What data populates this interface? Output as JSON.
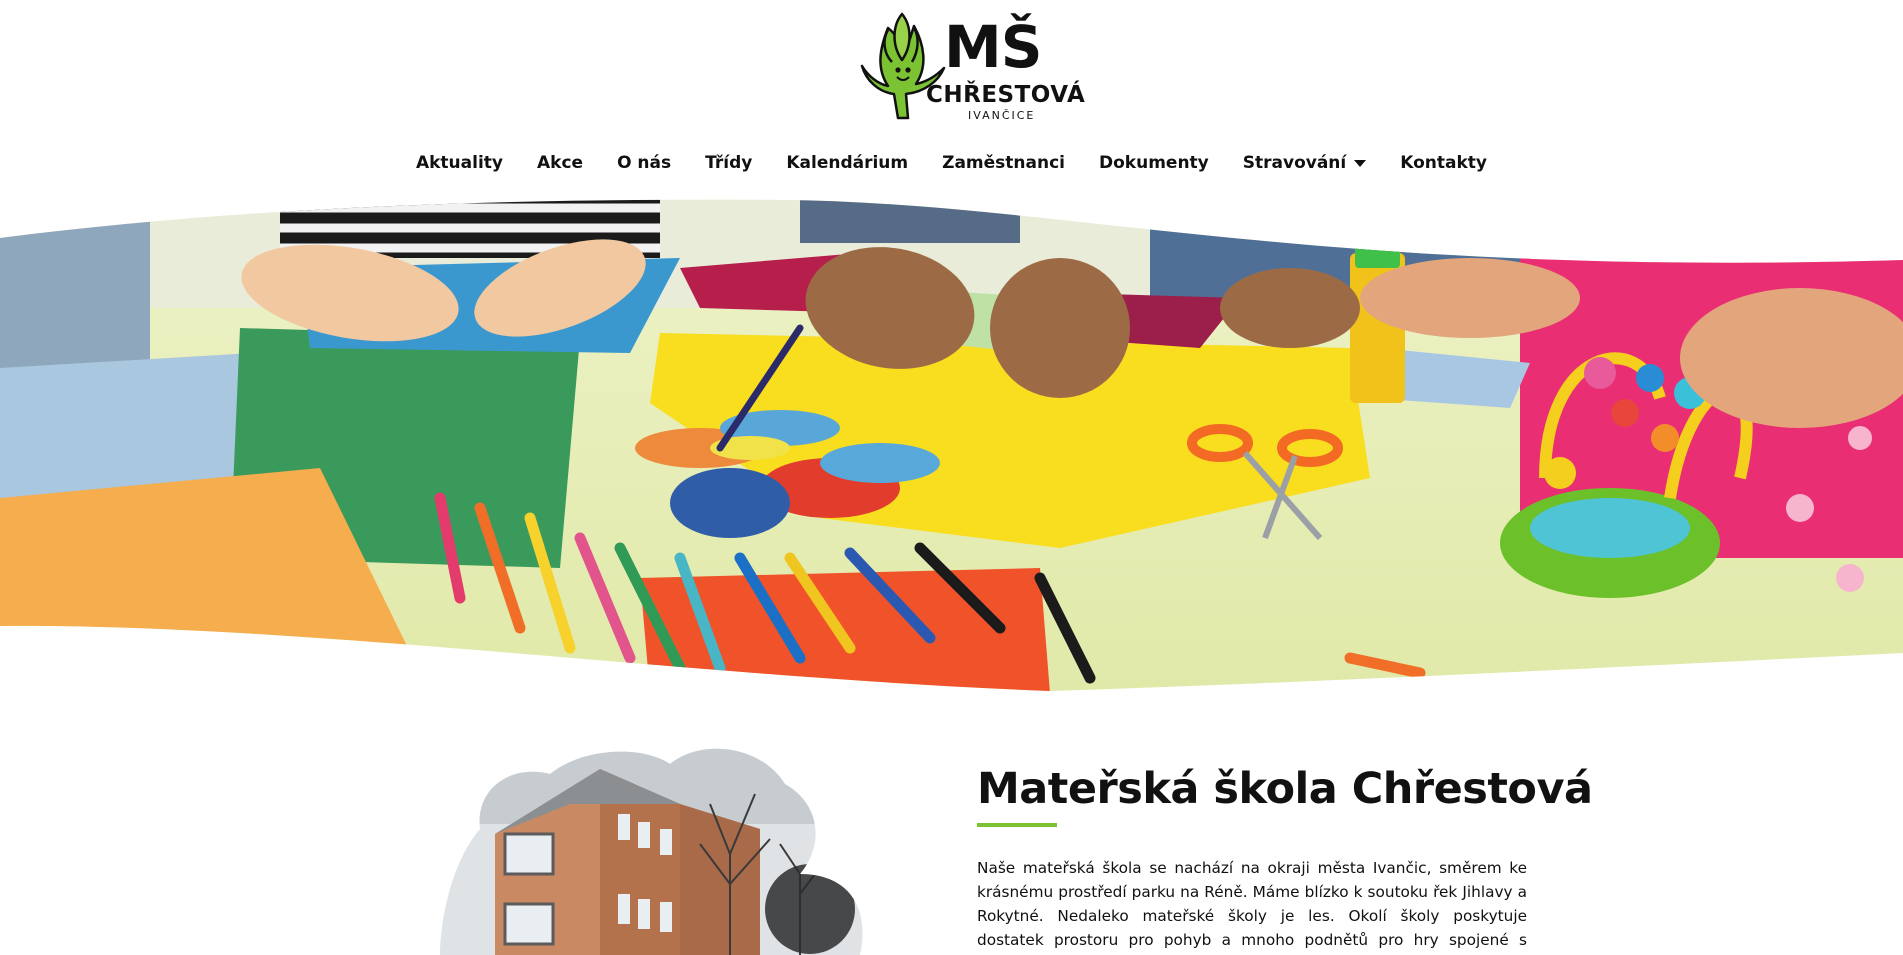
{
  "logo": {
    "line1": "MŠ",
    "line2": "CHŘESTOVÁ",
    "line3": "IVANČICE",
    "mascot_icon": "asparagus-mascot-icon"
  },
  "nav": {
    "items": [
      {
        "label": "Aktuality"
      },
      {
        "label": "Akce"
      },
      {
        "label": "O nás"
      },
      {
        "label": "Třídy"
      },
      {
        "label": "Kalendárium"
      },
      {
        "label": "Zaměstnanci"
      },
      {
        "label": "Dokumenty"
      },
      {
        "label": "Stravování",
        "has_dropdown": true
      },
      {
        "label": "Kontakty"
      }
    ]
  },
  "about": {
    "title": "Mateřská škola Chřestová",
    "text": "Naše mateřská škola se nachází na okraji města Ivančic, směrem ke krásnému prostředí parku na Réně. Máme blízko k soutoku řek Jihlavy a Rokytné. Nedaleko mateřské školy je les. Okolí školy poskytuje dostatek prostoru pro pohyb a mnoho podnětů pro hry spojené s poznáváním přírody a jejich zákonitostí."
  },
  "colors": {
    "accent_green": "#7cc334",
    "text": "#111111",
    "background": "#ffffff"
  }
}
